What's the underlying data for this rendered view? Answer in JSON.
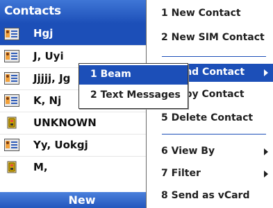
{
  "header": {
    "title": "Contacts"
  },
  "contacts": [
    {
      "name": "Hgj",
      "icon": "contact-card-icon",
      "selected": true
    },
    {
      "name": "J, Uyi",
      "icon": "contact-card-icon",
      "selected": false
    },
    {
      "name": "Jjjjj, Jg",
      "icon": "contact-card-icon",
      "selected": false
    },
    {
      "name": "K, Nj",
      "icon": "contact-card-icon",
      "selected": false
    },
    {
      "name": "UNKNOWN",
      "icon": "sim-contact-icon",
      "selected": false
    },
    {
      "name": "Yy, Uokgj",
      "icon": "contact-card-icon",
      "selected": false
    },
    {
      "name": "M,",
      "icon": "sim-contact-icon",
      "selected": false
    }
  ],
  "softkeys": {
    "left": "New"
  },
  "menu": {
    "items": [
      {
        "label": "1 New Contact"
      },
      {
        "label": "2 New SIM Contact"
      },
      {
        "label": "3 Send Contact",
        "highlighted": true,
        "submenu": true
      },
      {
        "label": "4 Copy Contact"
      },
      {
        "label": "5 Delete Contact"
      },
      {
        "label": "6 View By",
        "submenu": true
      },
      {
        "label": "7 Filter",
        "submenu": true
      },
      {
        "label": "8 Send as vCard"
      }
    ]
  },
  "submenu": {
    "items": [
      {
        "label": "1 Beam",
        "highlighted": true
      },
      {
        "label": "2 Text Messages"
      }
    ]
  },
  "colors": {
    "accent": "#1c4fb8",
    "title_bar": "#2a5fc4",
    "text": "#1f1f1f"
  }
}
